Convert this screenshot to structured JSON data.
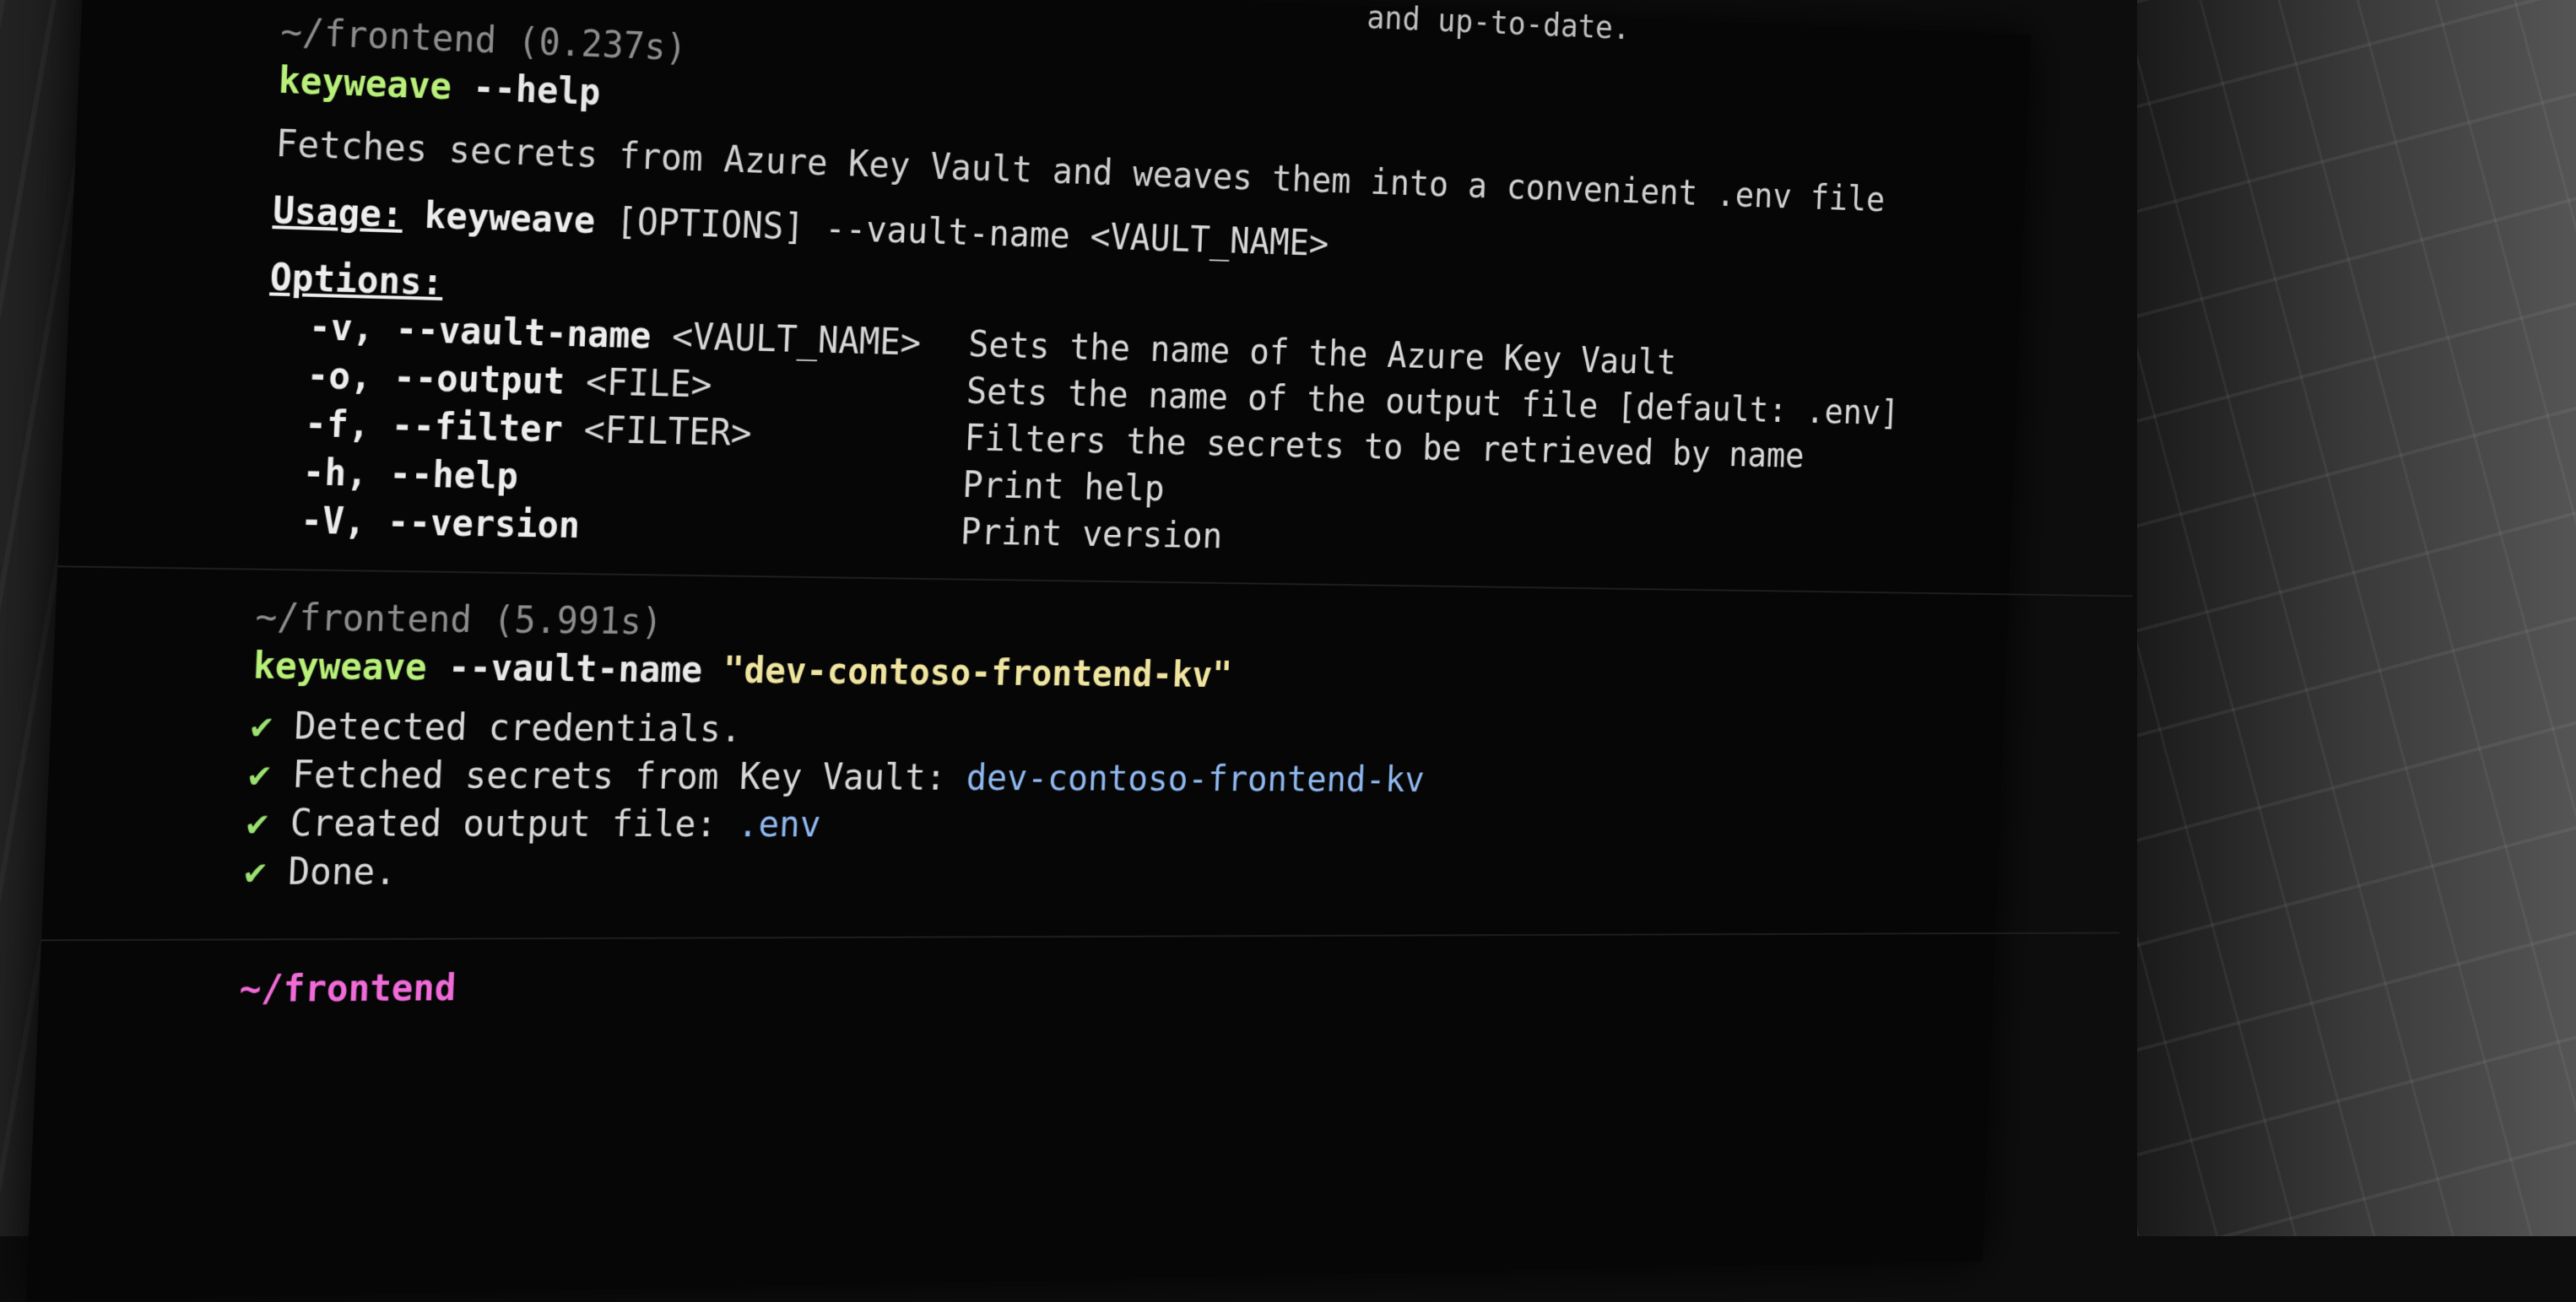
{
  "blocks": [
    {
      "prompt": "~/frontend (0.237s)",
      "command": "keyweave",
      "args": " --help",
      "description": "Fetches secrets from Azure Key Vault and weaves them into a convenient .env file",
      "usage_label": "Usage:",
      "usage_cmd": "keyweave",
      "usage_rest": " [OPTIONS] --vault-name <VAULT_NAME>",
      "options_label": "Options:",
      "options": [
        {
          "flag": "-v, --vault-name",
          "arg": " <VAULT_NAME>",
          "desc": "Sets the name of the Azure Key Vault"
        },
        {
          "flag": "-o, --output",
          "arg": " <FILE>",
          "desc": "Sets the name of the output file [default: .env]"
        },
        {
          "flag": "-f, --filter",
          "arg": " <FILTER>",
          "desc": "Filters the secrets to be retrieved by name"
        },
        {
          "flag": "-h, --help",
          "arg": "",
          "desc": "Print help"
        },
        {
          "flag": "-V, --version",
          "arg": "",
          "desc": "Print version"
        }
      ]
    },
    {
      "prompt": "~/frontend (5.991s)",
      "command": "keyweave",
      "flag": " --vault-name ",
      "value": "\"dev-contoso-frontend-kv\"",
      "results": [
        {
          "text": "Detected credentials.",
          "extra": ""
        },
        {
          "text": "Fetched secrets from Key Vault: ",
          "extra": "dev-contoso-frontend-kv"
        },
        {
          "text": "Created output file: ",
          "extra": ".env"
        },
        {
          "text": "Done.",
          "extra": ""
        }
      ]
    }
  ],
  "top_right_fragment": "and up-to-date.",
  "check_glyph": "✔",
  "current_prompt": "~/frontend",
  "colors": {
    "command": "#b8f07a",
    "string": "#f0e5a0",
    "link": "#8fb8f0",
    "prompt": "#f06ad8"
  }
}
